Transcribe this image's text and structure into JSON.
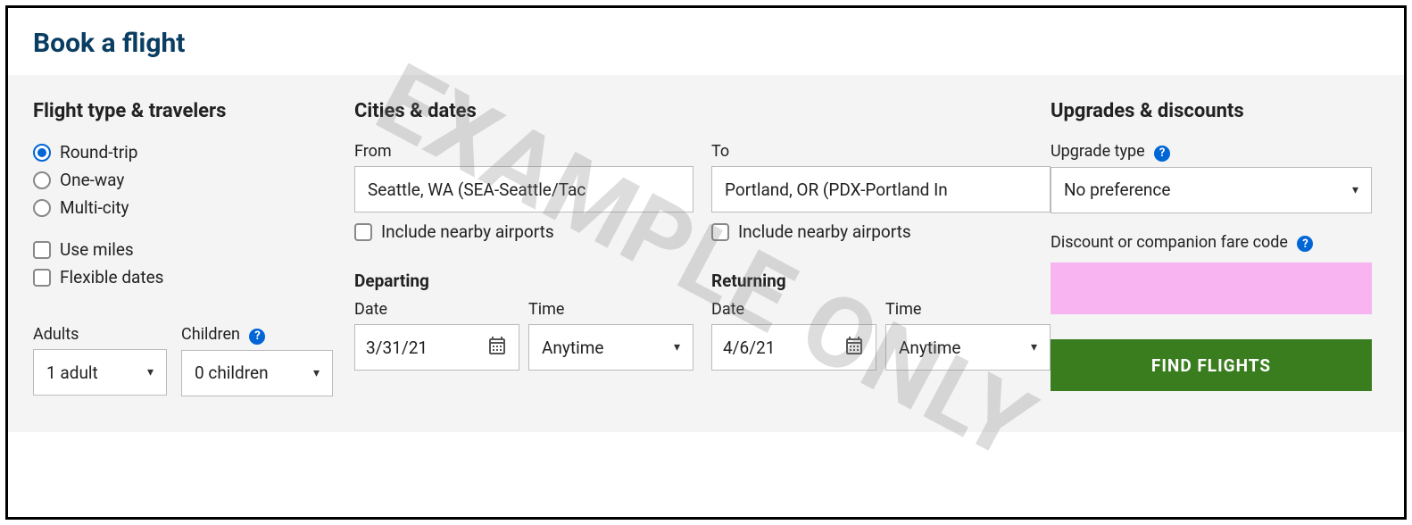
{
  "title": "Book a flight",
  "watermark": "EXAMPLE ONLY",
  "left": {
    "heading": "Flight type & travelers",
    "trip_types": [
      {
        "label": "Round-trip",
        "checked": true
      },
      {
        "label": "One-way",
        "checked": false
      },
      {
        "label": "Multi-city",
        "checked": false
      }
    ],
    "options": [
      {
        "label": "Use miles",
        "checked": false
      },
      {
        "label": "Flexible dates",
        "checked": false
      }
    ],
    "adults_label": "Adults",
    "children_label": "Children",
    "adults_value": "1 adult",
    "children_value": "0 children"
  },
  "mid": {
    "heading": "Cities & dates",
    "from_label": "From",
    "to_label": "To",
    "from_value": "Seattle, WA (SEA-Seattle/Tac",
    "to_value": "Portland, OR (PDX-Portland In",
    "nearby_label": "Include nearby airports",
    "departing_label": "Departing",
    "returning_label": "Returning",
    "date_label": "Date",
    "time_label": "Time",
    "depart_date": "3/31/21",
    "depart_time": "Anytime",
    "return_date": "4/6/21",
    "return_time": "Anytime"
  },
  "right": {
    "heading": "Upgrades & discounts",
    "upgrade_label": "Upgrade type",
    "upgrade_value": "No preference",
    "discount_label": "Discount or companion fare code",
    "find_label": "FIND FLIGHTS"
  }
}
